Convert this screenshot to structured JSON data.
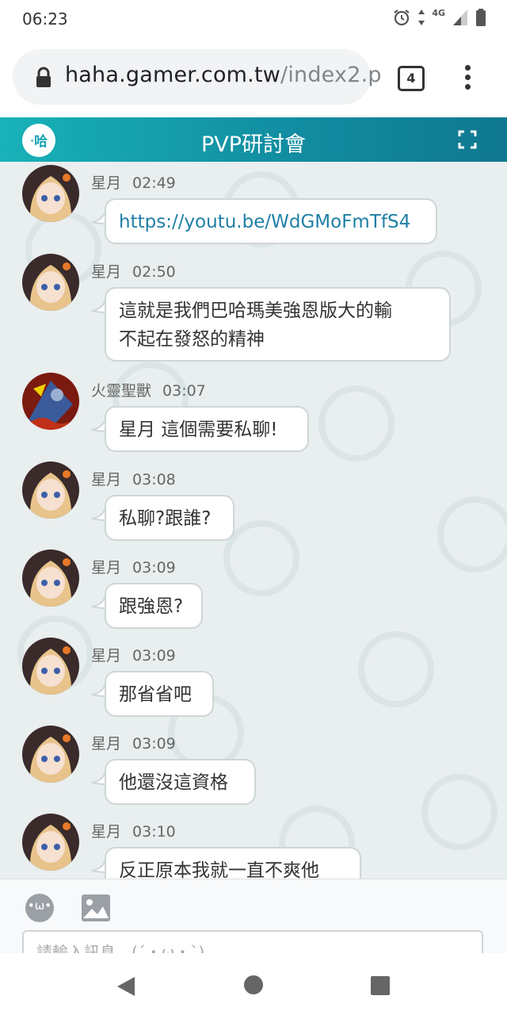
{
  "status": {
    "time": "06:23",
    "network": "4G"
  },
  "browser": {
    "url_host": "haha.gamer.com.tw",
    "url_path": "/index2.p",
    "tab_count": "4"
  },
  "header": {
    "title": "PVP研討會"
  },
  "messages": [
    {
      "user": "星月",
      "time": "02:49",
      "text": "https://youtu.be/WdGMoFmTfS4"
    },
    {
      "user": "星月",
      "time": "02:50",
      "line1": "這就是我們巴哈瑪美強恩版大的輸",
      "line2": "不起在發怒的精神"
    },
    {
      "user": "火靈聖獸",
      "time": "03:07",
      "text": "星月 這個需要私聊!"
    },
    {
      "user": "星月",
      "time": "03:08",
      "text": "私聊?跟誰?"
    },
    {
      "user": "星月",
      "time": "03:09",
      "text": "跟強恩?"
    },
    {
      "user": "星月",
      "time": "03:09",
      "text": "那省省吧"
    },
    {
      "user": "星月",
      "time": "03:09",
      "text": "他還沒這資格"
    },
    {
      "user": "星月",
      "time": "03:10",
      "text": "反正原本我就一直不爽他"
    }
  ],
  "composer": {
    "placeholder": "請輸入訊息…(´・ω・`)",
    "emoji_glyph": "•ω•"
  }
}
